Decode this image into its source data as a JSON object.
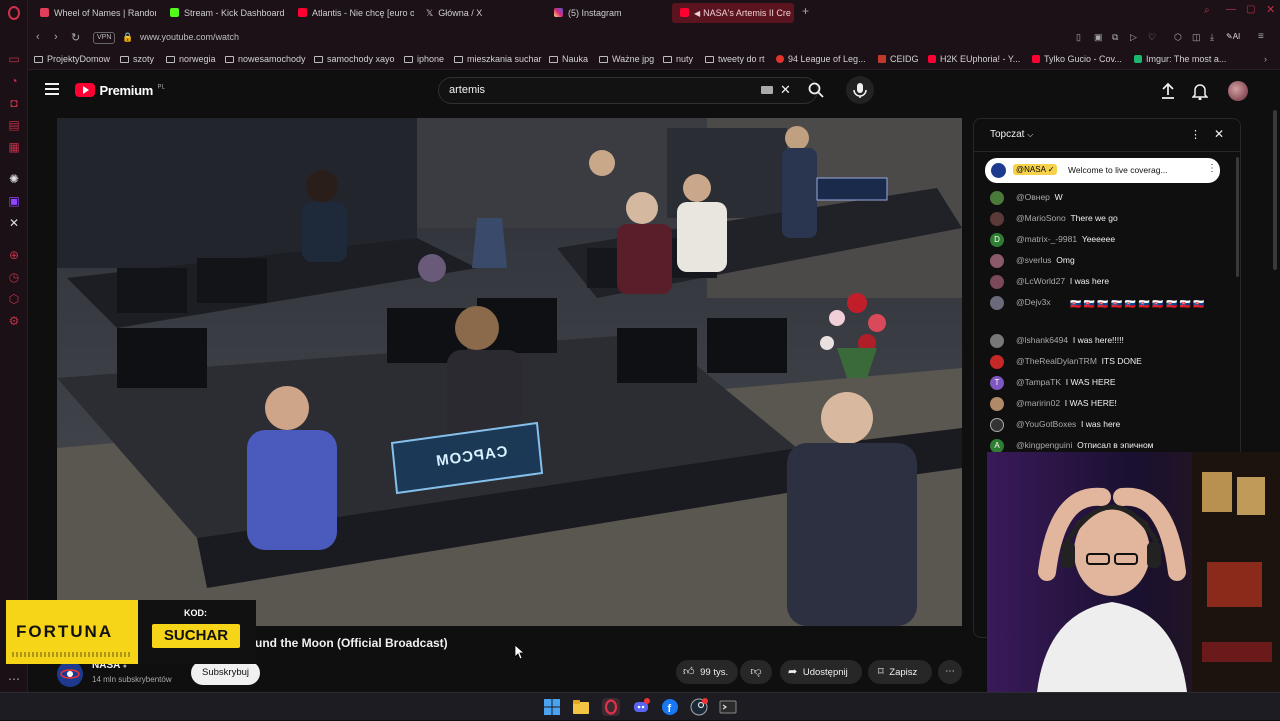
{
  "browser": {
    "tabs": [
      {
        "label": "Wheel of Names | Random",
        "color": "#e43d5b",
        "active": false
      },
      {
        "label": "Stream - Kick Dashboard",
        "color": "#53fc18",
        "active": false
      },
      {
        "label": "Atlantis - Nie chcę [euro o",
        "color": "#ff0033",
        "active": false
      },
      {
        "label": "Główna / X",
        "color": "#e7e7e7",
        "active": false
      },
      {
        "label": "(5) Instagram",
        "color": "#d62976",
        "active": false
      },
      {
        "label": "NASA's Artemis II Cre",
        "color": "#ff0033",
        "active": true
      }
    ],
    "new_tab": "+",
    "vpn_label": "VPN",
    "url": "www.youtube.com/watch",
    "ai_label": "AI",
    "bookmarks": [
      {
        "label": "ProjektyDomow",
        "type": "folder"
      },
      {
        "label": "szoty",
        "type": "folder"
      },
      {
        "label": "norwegia",
        "type": "folder"
      },
      {
        "label": "nowesamochody",
        "type": "folder"
      },
      {
        "label": "samochody xayo",
        "type": "folder"
      },
      {
        "label": "iphone",
        "type": "folder"
      },
      {
        "label": "mieszkania suchar",
        "type": "folder"
      },
      {
        "label": "Nauka",
        "type": "folder"
      },
      {
        "label": "Ważne jpg",
        "type": "folder"
      },
      {
        "label": "nuty",
        "type": "folder"
      },
      {
        "label": "tweety do rt",
        "type": "folder"
      },
      {
        "label": "94 League of Leg...",
        "type": "site",
        "color": "#e2342b"
      },
      {
        "label": "CEIDG",
        "type": "site",
        "color": "#c0392b"
      },
      {
        "label": "H2K EUphoria! - Y...",
        "type": "site",
        "color": "#ff0033"
      },
      {
        "label": "Tylko Gucio - Cov...",
        "type": "site",
        "color": "#ff0033"
      },
      {
        "label": "Imgur: The most a...",
        "type": "site",
        "color": "#1bb76e"
      }
    ]
  },
  "youtube": {
    "logo_text": "Premium",
    "logo_region": "PL",
    "search_value": "artemis",
    "video_title": "und the Moon (Official Broadcast)",
    "channel_name": "NASA",
    "subscribers": "14 mln subskrybentów",
    "subscribe_label": "Subskrybuj",
    "likes": "99 tys.",
    "share_label": "Udostępnij",
    "save_label": "Zapisz",
    "capcom_sign": "CAPCOM"
  },
  "chat": {
    "header": "Topczat",
    "pinned_user": "@NASA",
    "pinned_message": "Welcome to live coverag...",
    "messages": [
      {
        "user": "@Овнер",
        "msg": "W",
        "color": "#4a7a3a",
        "initial": ""
      },
      {
        "user": "@MarioSono",
        "msg": "There we go",
        "color": "#5b3a3a",
        "initial": ""
      },
      {
        "user": "@matrix-_-9981",
        "msg": "Yeeeeee",
        "color": "#2e7d32",
        "initial": "D"
      },
      {
        "user": "@sverlus",
        "msg": "Omg",
        "color": "#8a5a6a",
        "initial": ""
      },
      {
        "user": "@LcWorld27",
        "msg": "I was here",
        "color": "#7a4a5a",
        "initial": ""
      },
      {
        "user": "@Dejv3x",
        "msg": "🇸🇰 🇸🇰 🇸🇰 🇸🇰 🇸🇰 🇸🇰 🇸🇰 🇸🇰 🇸🇰 🇸🇰",
        "color": "#6a6a7a",
        "initial": ""
      },
      {
        "user": "@lshank6494",
        "msg": "I was here!!!!!",
        "color": "#777",
        "initial": ""
      },
      {
        "user": "@TheRealDylanTRM",
        "msg": "ITS DONE",
        "color": "#c62828",
        "initial": ""
      },
      {
        "user": "@TampaTK",
        "msg": "I WAS HERE",
        "color": "#7e57c2",
        "initial": "T"
      },
      {
        "user": "@maririn02",
        "msg": "I WAS HERE!",
        "color": "#b08968",
        "initial": ""
      },
      {
        "user": "@YouGotBoxes",
        "msg": "I was here",
        "color": "#333",
        "initial": ""
      },
      {
        "user": "@kingpenguini",
        "msg": "Отписал в эпичном",
        "color": "#2e7d32",
        "initial": "A"
      }
    ]
  },
  "overlay": {
    "brand": "FORTUNA",
    "code_label": "KOD:",
    "code_value": "SUCHAR"
  },
  "colors": {
    "accent": "#ff0033",
    "opera": "#c2314a",
    "fortuna_yellow": "#f6d417"
  }
}
